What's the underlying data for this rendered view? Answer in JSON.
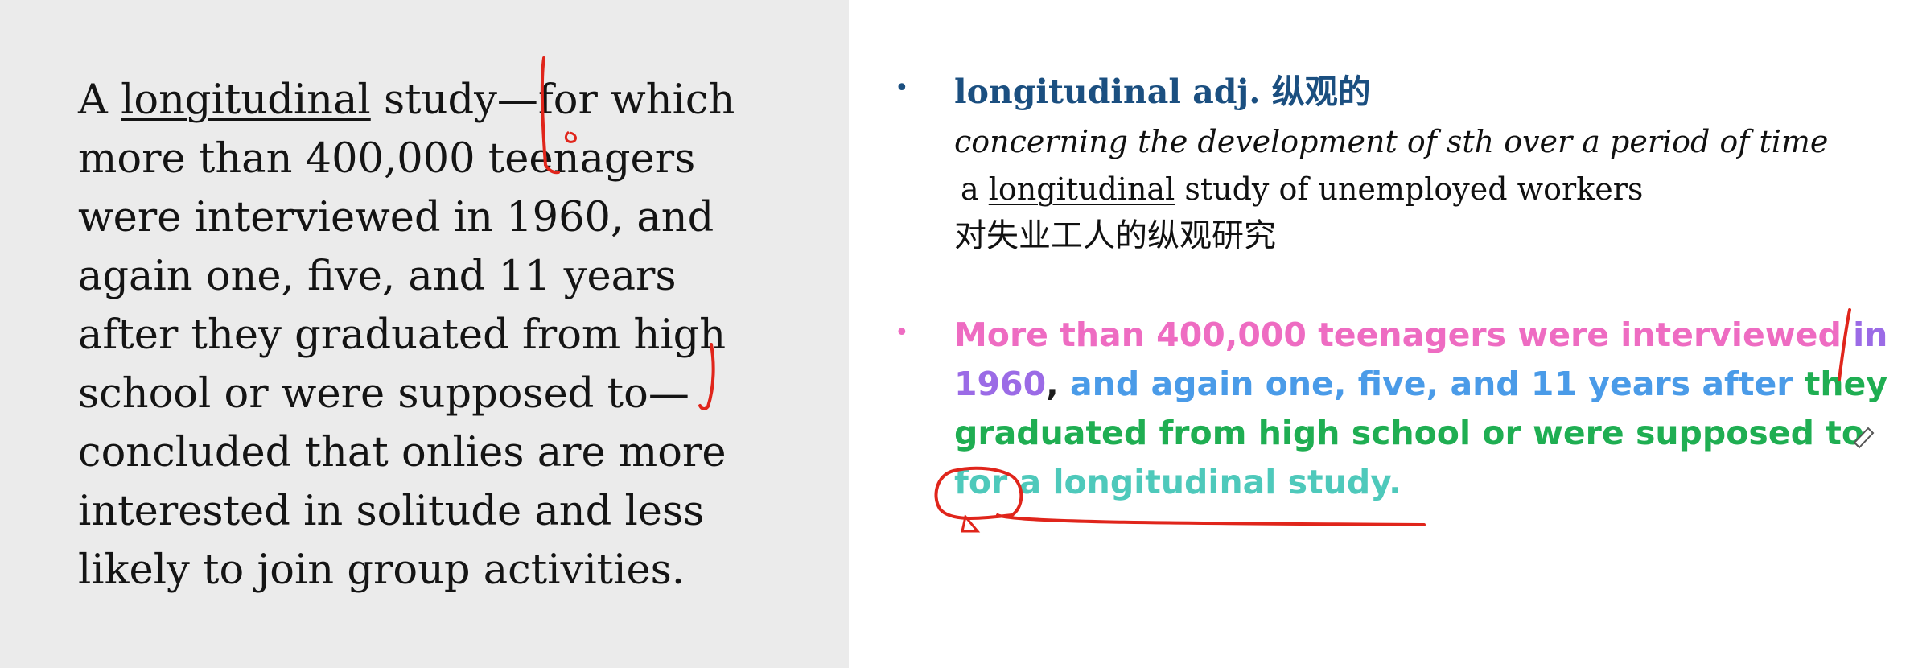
{
  "passage": {
    "w_a": "A",
    "w_longitudinal": "longitudinal",
    "line1_rest": " study—for which",
    "line2": "more than 400,000 teenagers",
    "line3": "were interviewed in 1960, and",
    "line4": "again one, five, and 11 years",
    "line5": "after they graduated from high",
    "line6": "school or were supposed to—",
    "line7": "concluded that onlies are more",
    "line8": "interested in solitude and less",
    "line9": "likely to join group activities."
  },
  "vocab": {
    "bullet": "•",
    "headword": "longitudinal adj. 纵观的",
    "definition": "concerning the development of sth over a period of time",
    "example_a": "a",
    "example_word": "longitudinal",
    "example_rest": " study of unemployed workers",
    "translation": "对失业工人的纵观研究"
  },
  "rewrite": {
    "bullet": "•",
    "seg_pink": "More than 400,000 teenagers were interviewed ",
    "seg_purple": "in 1960",
    "seg_comma": ",",
    "seg_blue": " and again one, five, and 11 years after ",
    "seg_green": "they graduated from high school or were supposed to ",
    "seg_teal": "for a longitudinal study."
  },
  "colors": {
    "left_bg": "#ebebeb",
    "heading_blue": "#1b4f80",
    "pink": "#ee6cc2",
    "purple": "#9b6be6",
    "blue": "#4a9be8",
    "green": "#1fae52",
    "teal": "#4ec9bb",
    "ink_red": "#e0251b"
  }
}
